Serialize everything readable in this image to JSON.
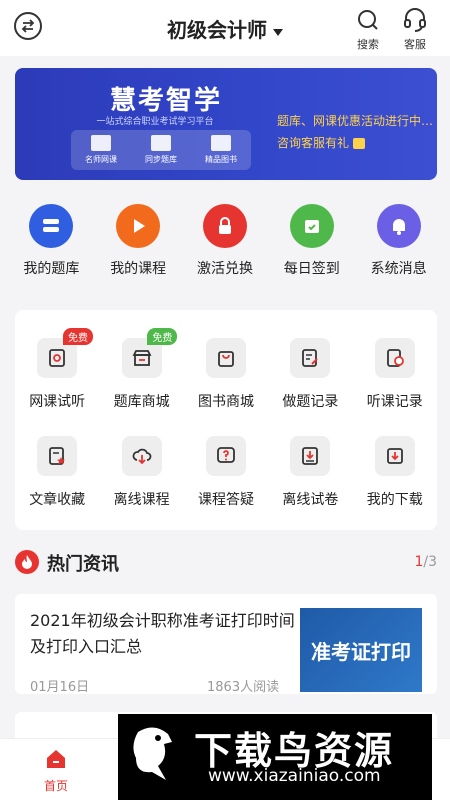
{
  "header": {
    "title": "初级会计师",
    "search_label": "搜索",
    "service_label": "客服"
  },
  "banner": {
    "logo": "慧考智学",
    "subtitle": "一站式综合职业考试学习平台",
    "cards": [
      "名师网课",
      "同步题库",
      "精品图书"
    ],
    "line1": "题库、网课优惠活动进行中…",
    "line2": "咨询客服有礼"
  },
  "quick_actions": [
    {
      "label": "我的题库",
      "color": "#2f5fe0",
      "icon": "stack-icon"
    },
    {
      "label": "我的课程",
      "color": "#f26a1b",
      "icon": "play-icon"
    },
    {
      "label": "激活兑换",
      "color": "#e63530",
      "icon": "lock-icon"
    },
    {
      "label": "每日签到",
      "color": "#4fb84a",
      "icon": "checkin-icon"
    },
    {
      "label": "系统消息",
      "color": "#6b5fe6",
      "icon": "bell-icon"
    }
  ],
  "grid": [
    {
      "label": "网课试听",
      "badge": "免费",
      "badge_color": "#e63530"
    },
    {
      "label": "题库商城",
      "badge": "免费",
      "badge_color": "#4fb84a"
    },
    {
      "label": "图书商城",
      "badge": ""
    },
    {
      "label": "做题记录",
      "badge": ""
    },
    {
      "label": "听课记录",
      "badge": ""
    },
    {
      "label": "文章收藏",
      "badge": ""
    },
    {
      "label": "离线课程",
      "badge": ""
    },
    {
      "label": "课程答疑",
      "badge": ""
    },
    {
      "label": "离线试卷",
      "badge": ""
    },
    {
      "label": "我的下载",
      "badge": ""
    }
  ],
  "news": {
    "title": "热门资讯",
    "page_current": "1",
    "page_total": "/3",
    "items": [
      {
        "headline": "2021年初级会计职称准考证打印时间及打印入口汇总",
        "date": "01月16日",
        "reads": "1863人阅读",
        "thumb_text": "准考证打印"
      }
    ]
  },
  "tabbar": {
    "home_label": "首页"
  },
  "watermark": {
    "main": "下载鸟资源",
    "url": "www.xiazainiao.com"
  },
  "colors": {
    "accent": "#e63530",
    "banner": "#2c3bb8"
  }
}
